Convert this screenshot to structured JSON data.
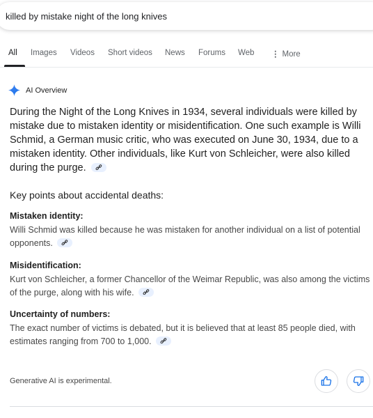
{
  "search": {
    "value": "killed by mistake night of the long knives"
  },
  "tabs": [
    {
      "label": "All"
    },
    {
      "label": "Images"
    },
    {
      "label": "Videos"
    },
    {
      "label": "Short videos"
    },
    {
      "label": "News"
    },
    {
      "label": "Forums"
    },
    {
      "label": "Web"
    },
    {
      "label": "More"
    }
  ],
  "ai_overview": {
    "title": "AI Overview",
    "summary": "During the Night of the Long Knives in 1934, several individuals were killed by mistake due to mistaken identity or misidentification. One such example is Willi Schmid, a German music critic, who was executed on June 30, 1934, due to a mistaken identity. Other individuals, like Kurt von Schleicher, were also killed during the purge.",
    "key_points_heading": "Key points about accidental deaths:",
    "key_points": [
      {
        "title": "Mistaken identity:",
        "text": "Willi Schmid was killed because he was mistaken for another individual on a list of potential opponents."
      },
      {
        "title": "Misidentification:",
        "text": "Kurt von Schleicher, a former Chancellor of the Weimar Republic, was also among the victims of the purge, along with his wife."
      },
      {
        "title": "Uncertainty of numbers:",
        "text": "The exact number of victims is debated, but it is believed that at least 85 people died, with estimates ranging from 700 to 1,000."
      }
    ],
    "footer": "Generative AI is experimental."
  },
  "icons": {
    "sparkle": "gemini-sparkle-icon",
    "link": "link-icon",
    "thumbs_up": "thumbs-up-icon",
    "thumbs_down": "thumbs-down-icon",
    "more": "vertical-dots-icon"
  },
  "colors": {
    "accent_blue": "#4285f4",
    "chip_bg": "#e8f0fe",
    "text_primary": "#1f1f1f",
    "text_secondary": "#474747",
    "tab_inactive": "#5f6368"
  }
}
